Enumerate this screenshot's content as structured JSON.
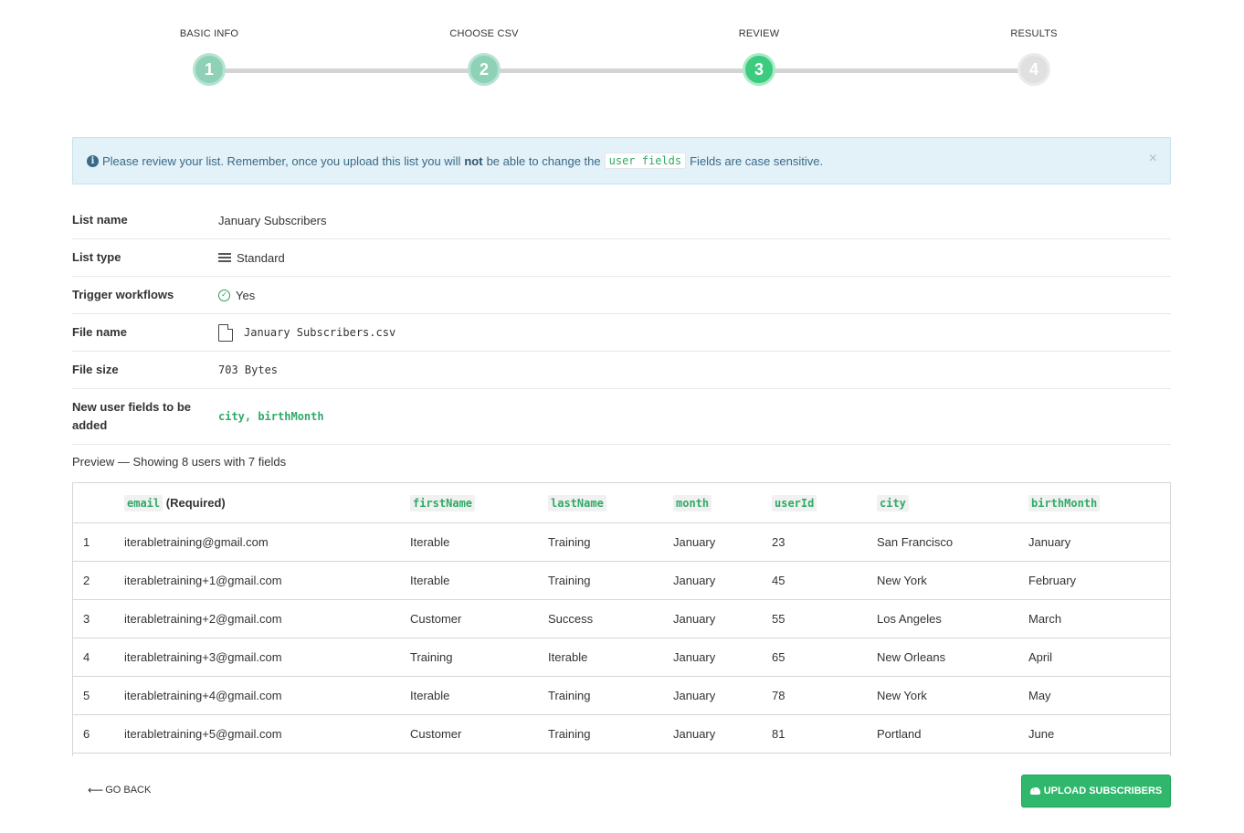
{
  "stepper": {
    "steps": [
      {
        "label": "Basic Info",
        "number": "1",
        "state": "done"
      },
      {
        "label": "Choose CSV",
        "number": "2",
        "state": "done"
      },
      {
        "label": "Review",
        "number": "3",
        "state": "active"
      },
      {
        "label": "Results",
        "number": "4",
        "state": "todo"
      }
    ]
  },
  "alert": {
    "text_before": "Please review your list. Remember, once you upload this list you will",
    "bold": "not",
    "text_middle": "be able to change the",
    "code": "user fields",
    "text_after": "Fields are case sensitive.",
    "close": "×"
  },
  "details": {
    "list_name": {
      "label": "List name",
      "value": "January Subscribers"
    },
    "list_type": {
      "label": "List type",
      "value": "Standard",
      "icon": "list-icon"
    },
    "trigger_workflows": {
      "label": "Trigger workflows",
      "value": "Yes",
      "icon": "check-circle-icon"
    },
    "file_name": {
      "label": "File name",
      "value": "January Subscribers.csv",
      "icon": "file-icon"
    },
    "file_size": {
      "label": "File size",
      "value": "703 Bytes"
    },
    "new_fields": {
      "label": "New user fields to be added",
      "value": "city, birthMonth"
    }
  },
  "preview": {
    "label": "Preview — Showing 8 users with 7 fields"
  },
  "table": {
    "headers": [
      {
        "code": "email",
        "suffix": "(Required)"
      },
      {
        "code": "firstName"
      },
      {
        "code": "lastName"
      },
      {
        "code": "month"
      },
      {
        "code": "userId"
      },
      {
        "code": "city"
      },
      {
        "code": "birthMonth"
      }
    ],
    "rows": [
      [
        "1",
        "iterabletraining@gmail.com",
        "Iterable",
        "Training",
        "January",
        "23",
        "San Francisco",
        "January"
      ],
      [
        "2",
        "iterabletraining+1@gmail.com",
        "Iterable",
        "Training",
        "January",
        "45",
        "New York",
        "February"
      ],
      [
        "3",
        "iterabletraining+2@gmail.com",
        "Customer",
        "Success",
        "January",
        "55",
        "Los Angeles",
        "March"
      ],
      [
        "4",
        "iterabletraining+3@gmail.com",
        "Training",
        "Iterable",
        "January",
        "65",
        "New Orleans",
        "April"
      ],
      [
        "5",
        "iterabletraining+4@gmail.com",
        "Iterable",
        "Training",
        "January",
        "78",
        "New York",
        "May"
      ],
      [
        "6",
        "iterabletraining+5@gmail.com",
        "Customer",
        "Training",
        "January",
        "81",
        "Portland",
        "June"
      ]
    ]
  },
  "footer": {
    "go_back": "Go Back",
    "upload": "Upload Subscribers"
  },
  "colors": {
    "accent_green": "#3ccb7f",
    "done_step": "#8fd1b7",
    "alert_bg": "#e3f1f8",
    "code_green": "#2fab66"
  }
}
